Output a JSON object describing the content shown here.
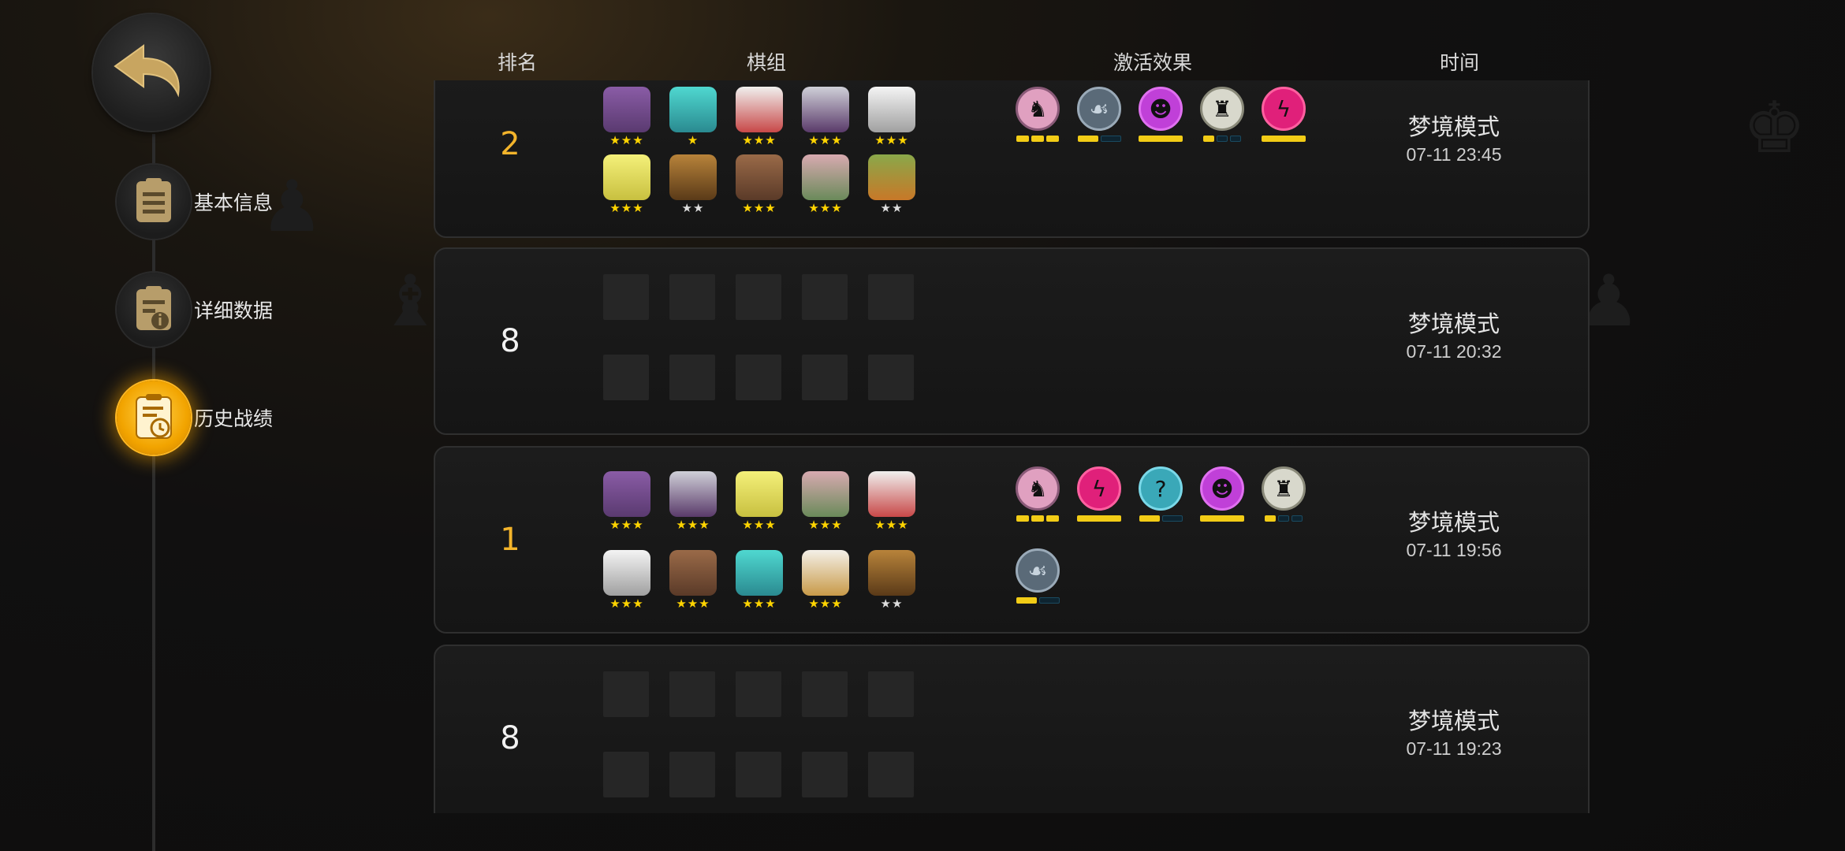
{
  "nav": {
    "items": [
      {
        "label": "基本信息",
        "icon": "document-icon",
        "active": false
      },
      {
        "label": "详细数据",
        "icon": "data-info-icon",
        "active": false
      },
      {
        "label": "历史战绩",
        "icon": "history-record-icon",
        "active": true
      }
    ]
  },
  "table": {
    "headers": {
      "rank": "排名",
      "lineup": "棋组",
      "traits": "激活效果",
      "time": "时间"
    }
  },
  "matches": [
    {
      "rank": "2",
      "mode": "梦境模式",
      "time": "07-11 23:45"
    },
    {
      "rank": "8",
      "mode": "梦境模式",
      "time": "07-11 20:32"
    },
    {
      "rank": "1",
      "mode": "梦境模式",
      "time": "07-11 19:56"
    },
    {
      "rank": "8",
      "mode": "梦境模式",
      "time": "07-11 19:23"
    }
  ],
  "stars": {
    "three": "★★★",
    "two": "★★",
    "one": "★"
  },
  "colors": {
    "gold": "#f3b42b",
    "star": "#ffd400",
    "bar_on": "#f2cc16"
  }
}
